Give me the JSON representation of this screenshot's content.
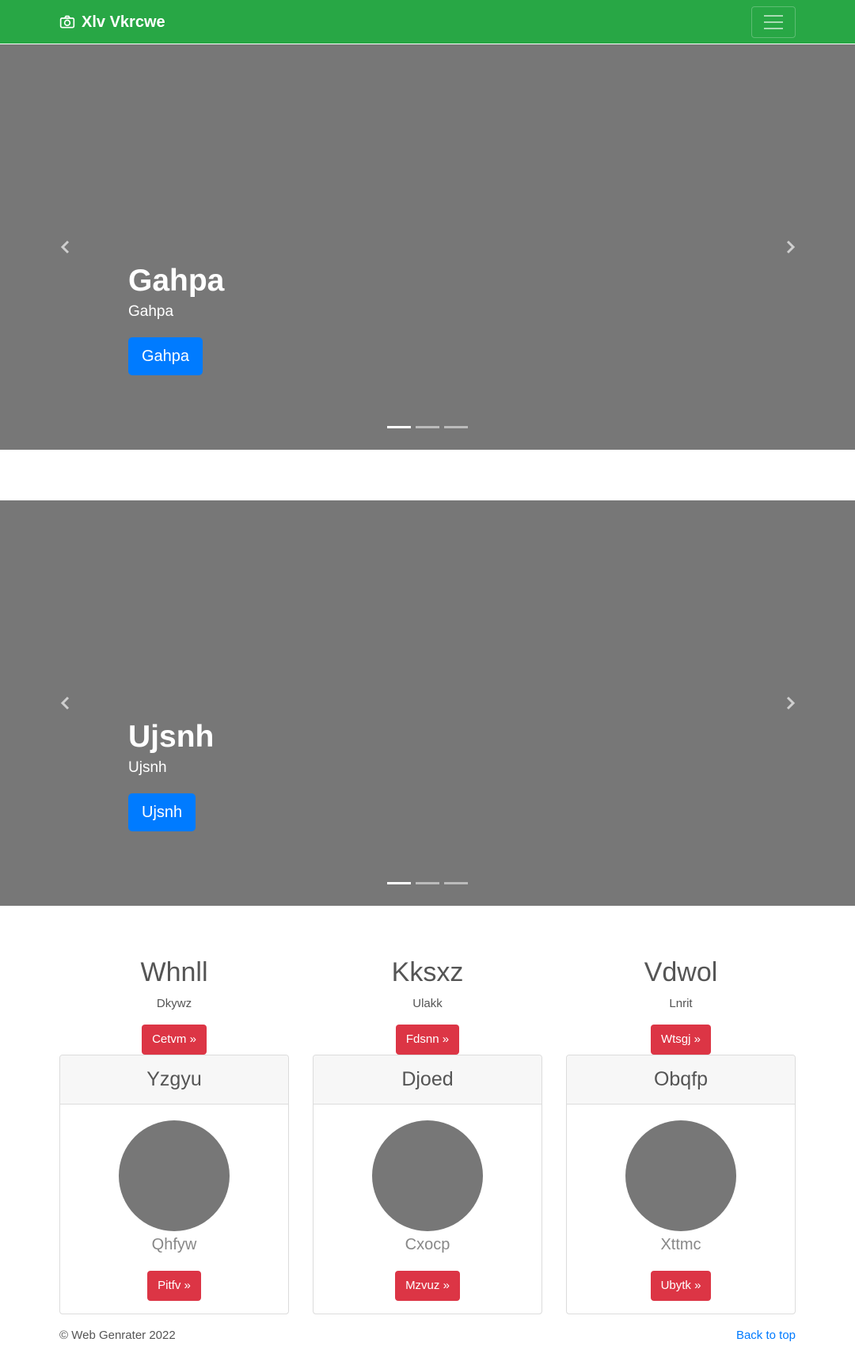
{
  "navbar": {
    "brand": "Xlv Vkrcwe",
    "brand_icon": "camera-icon",
    "toggle_icon": "hamburger-icon",
    "bg_color": "#28a745"
  },
  "carousels": [
    {
      "title": "Gahpa",
      "subtitle": "Gahpa",
      "button": "Gahpa",
      "indicators": 3,
      "active_indicator": 0
    },
    {
      "title": "Ujsnh",
      "subtitle": "Ujsnh",
      "button": "Ujsnh",
      "indicators": 3,
      "active_indicator": 0
    }
  ],
  "columns": [
    {
      "heading": "Whnll",
      "text": "Dkywz",
      "button": "Cetvm »"
    },
    {
      "heading": "Kksxz",
      "text": "Ulakk",
      "button": "Fdsnn »"
    },
    {
      "heading": "Vdwol",
      "text": "Lnrit",
      "button": "Wtsgj »"
    }
  ],
  "cards": [
    {
      "header": "Yzgyu",
      "title": "Qhfyw",
      "button": "Pitfv »"
    },
    {
      "header": "Djoed",
      "title": "Cxocp",
      "button": "Mzvuz »"
    },
    {
      "header": "Obqfp",
      "title": "Xttmc",
      "button": "Ubytk »"
    }
  ],
  "footer": {
    "copyright": "© Web Genrater 2022",
    "back_to_top": "Back to top"
  },
  "colors": {
    "primary": "#007bff",
    "danger": "#dc3545",
    "placeholder_gray": "#777777"
  }
}
